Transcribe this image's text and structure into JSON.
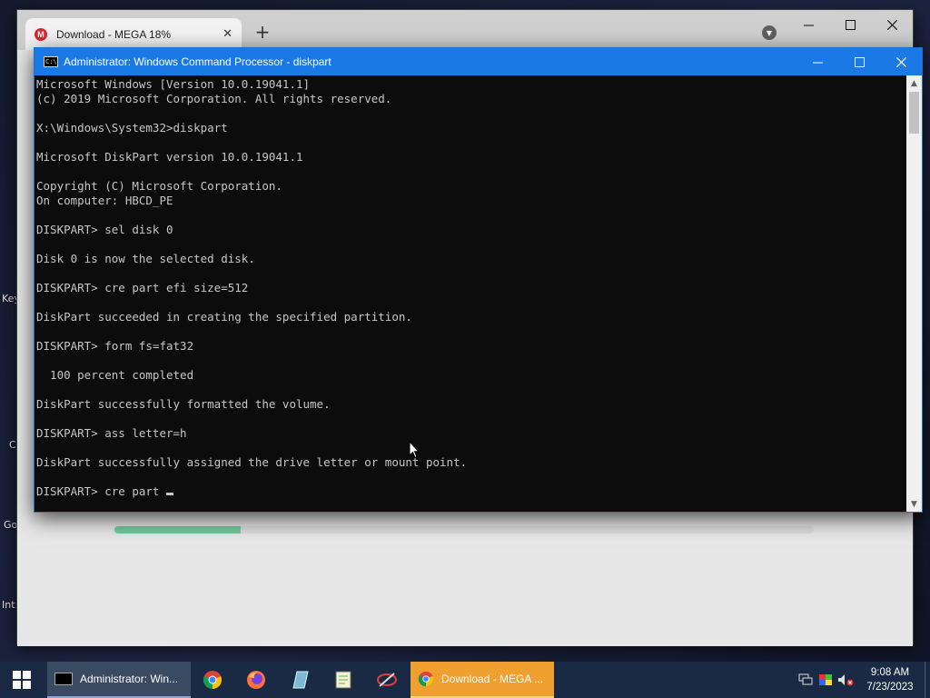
{
  "desktop": {
    "labels": [
      "Key",
      "C",
      "Go",
      "Int"
    ]
  },
  "chrome": {
    "tab_title": "Download - MEGA 18%",
    "tab_close": "✕",
    "new_tab": "+",
    "mega_progress_percent": 18
  },
  "cmd": {
    "title": "Administrator: Windows Command Processor - diskpart",
    "lines": [
      "Microsoft Windows [Version 10.0.19041.1]",
      "(c) 2019 Microsoft Corporation. All rights reserved.",
      "",
      "X:\\Windows\\System32>diskpart",
      "",
      "Microsoft DiskPart version 10.0.19041.1",
      "",
      "Copyright (C) Microsoft Corporation.",
      "On computer: HBCD_PE",
      "",
      "DISKPART> sel disk 0",
      "",
      "Disk 0 is now the selected disk.",
      "",
      "DISKPART> cre part efi size=512",
      "",
      "DiskPart succeeded in creating the specified partition.",
      "",
      "DISKPART> form fs=fat32",
      "",
      "  100 percent completed",
      "",
      "DiskPart successfully formatted the volume.",
      "",
      "DISKPART> ass letter=h",
      "",
      "DiskPart successfully assigned the drive letter or mount point.",
      "",
      "DISKPART> cre part "
    ]
  },
  "taskbar": {
    "cmd_label": "Administrator: Win...",
    "chrome_label": "Download - MEGA ...",
    "time": "9:08 AM",
    "date": "7/23/2023",
    "active_color": "#f0a030"
  }
}
